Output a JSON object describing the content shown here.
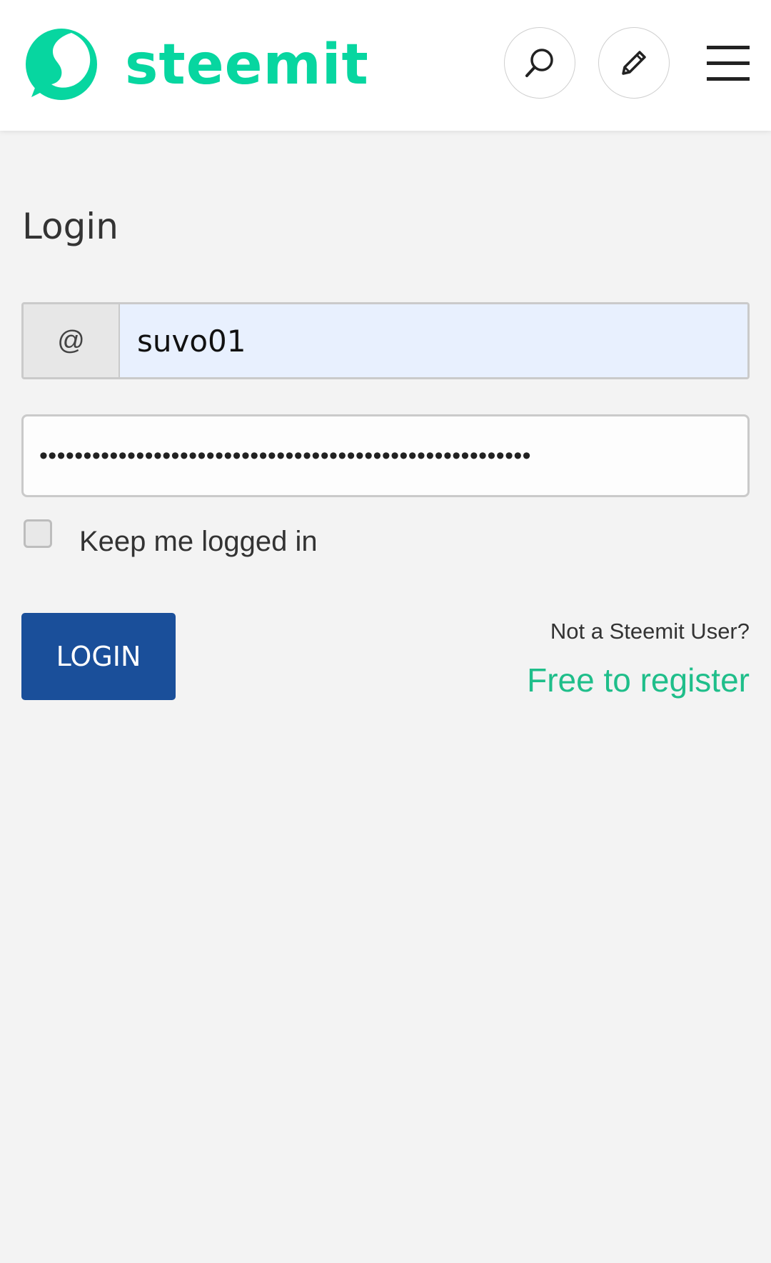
{
  "header": {
    "logo_text": "steemit",
    "brand_color": "#07d6a0",
    "icons": [
      "search-icon",
      "pencil-icon",
      "hamburger-menu-icon"
    ]
  },
  "login": {
    "title": "Login",
    "username_prefix": "@",
    "username_value": "suvo01",
    "password_masked": "••••••••••••••••••••••••••••••••••••••••••••••••••••••••",
    "keep_logged_in_label": "Keep me logged in",
    "keep_logged_in_checked": false,
    "login_button_label": "LOGIN",
    "register_prompt": "Not a Steemit User?",
    "register_link": "Free to register"
  },
  "colors": {
    "primary_button": "#1a4f9a",
    "link": "#1fbe8a",
    "background": "#f3f3f3"
  }
}
